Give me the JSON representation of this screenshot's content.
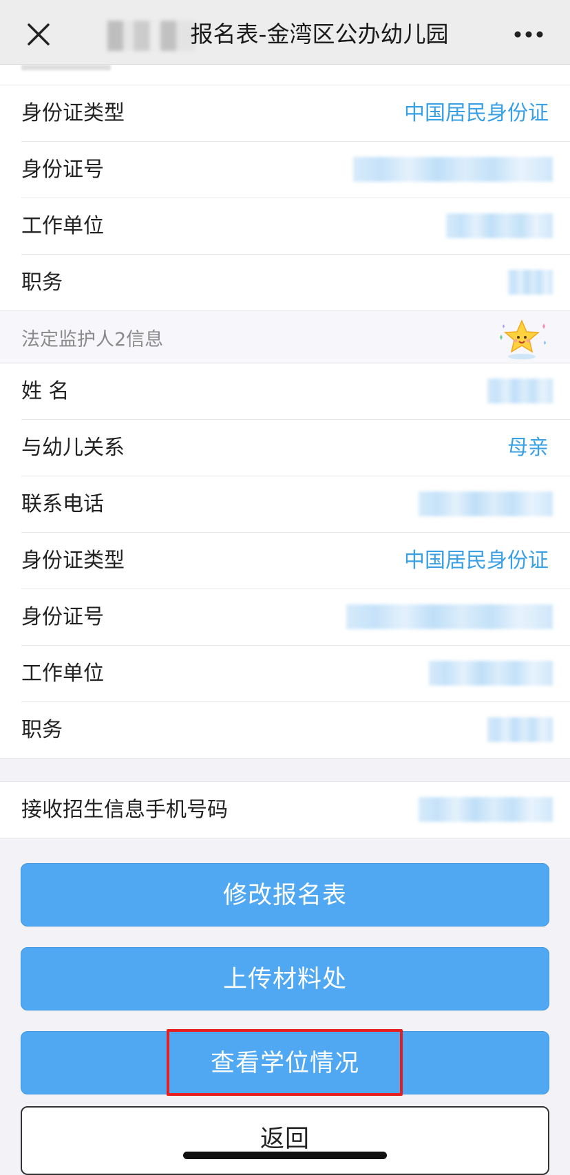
{
  "header": {
    "title": "报名表-金湾区公办幼儿园",
    "close_icon": "close-icon",
    "more_icon": "more-icon"
  },
  "guardian1": {
    "rows": [
      {
        "label": "身份证类型",
        "value": "中国居民身份证"
      },
      {
        "label": "身份证号",
        "value": ""
      },
      {
        "label": "工作单位",
        "value": ""
      },
      {
        "label": "职务",
        "value": ""
      }
    ]
  },
  "guardian2": {
    "section_title": "法定监护人2信息",
    "rows": [
      {
        "label": "姓 名",
        "value": ""
      },
      {
        "label": "与幼儿关系",
        "value": "母亲"
      },
      {
        "label": "联系电话",
        "value": ""
      },
      {
        "label": "身份证类型",
        "value": "中国居民身份证"
      },
      {
        "label": "身份证号",
        "value": ""
      },
      {
        "label": "工作单位",
        "value": ""
      },
      {
        "label": "职务",
        "value": ""
      }
    ]
  },
  "contact": {
    "label": "接收招生信息手机号码",
    "value": ""
  },
  "buttons": {
    "edit": "修改报名表",
    "upload": "上传材料处",
    "view_seat": "查看学位情况",
    "back": "返回"
  },
  "colors": {
    "accent": "#4fa8f1",
    "value_text": "#3aa0e4",
    "highlight": "#e61e1e"
  }
}
